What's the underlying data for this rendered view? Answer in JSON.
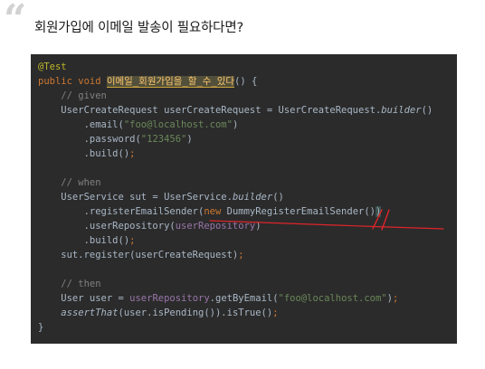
{
  "heading": {
    "quote_glyph": "“",
    "text": "회원가입에 이메일 발송이 필요하다면?"
  },
  "code": {
    "lines": [
      [
        {
          "t": "@Test",
          "c": "ann"
        }
      ],
      [
        {
          "t": "public void ",
          "c": "kw"
        },
        {
          "t": "이메일_회원가입을_할_수_있다",
          "c": "fn-hl"
        },
        {
          "t": "() {",
          "c": ""
        }
      ],
      [
        {
          "t": "    ",
          "c": ""
        },
        {
          "t": "// given",
          "c": "cmt"
        }
      ],
      [
        {
          "t": "    UserCreateRequest userCreateRequest = UserCreateRequest.",
          "c": ""
        },
        {
          "t": "builder",
          "c": "it"
        },
        {
          "t": "()",
          "c": ""
        }
      ],
      [
        {
          "t": "        .email(",
          "c": ""
        },
        {
          "t": "\"foo@localhost.com\"",
          "c": "str"
        },
        {
          "t": ")",
          "c": ""
        }
      ],
      [
        {
          "t": "        .password(",
          "c": ""
        },
        {
          "t": "\"123456\"",
          "c": "str"
        },
        {
          "t": ")",
          "c": ""
        }
      ],
      [
        {
          "t": "        .build()",
          "c": ""
        },
        {
          "t": ";",
          "c": "kw"
        }
      ],
      [
        {
          "t": "",
          "c": ""
        }
      ],
      [
        {
          "t": "    ",
          "c": ""
        },
        {
          "t": "// when",
          "c": "cmt"
        }
      ],
      [
        {
          "t": "    UserService sut = UserService.",
          "c": ""
        },
        {
          "t": "builder",
          "c": "it"
        },
        {
          "t": "()",
          "c": ""
        }
      ],
      [
        {
          "t": "        .registerEmailSender(",
          "c": ""
        },
        {
          "t": "new ",
          "c": "kw"
        },
        {
          "t": "DummyRegisterEmailSender()",
          "c": ""
        },
        {
          "t": ")",
          "c": "sel"
        }
      ],
      [
        {
          "t": "        .userRepository(",
          "c": ""
        },
        {
          "t": "userRepository",
          "c": "fld"
        },
        {
          "t": ")",
          "c": ""
        }
      ],
      [
        {
          "t": "        .build()",
          "c": ""
        },
        {
          "t": ";",
          "c": "kw"
        }
      ],
      [
        {
          "t": "    sut.register(userCreateRequest)",
          "c": ""
        },
        {
          "t": ";",
          "c": "kw"
        }
      ],
      [
        {
          "t": "",
          "c": ""
        }
      ],
      [
        {
          "t": "    ",
          "c": ""
        },
        {
          "t": "// then",
          "c": "cmt"
        }
      ],
      [
        {
          "t": "    User user = ",
          "c": ""
        },
        {
          "t": "userRepository",
          "c": "fld"
        },
        {
          "t": ".getByEmail(",
          "c": ""
        },
        {
          "t": "\"foo@localhost.com\"",
          "c": "str"
        },
        {
          "t": ")",
          "c": ""
        },
        {
          "t": ";",
          "c": "kw"
        }
      ],
      [
        {
          "t": "    ",
          "c": ""
        },
        {
          "t": "assertThat",
          "c": "it"
        },
        {
          "t": "(user.isPending()).isTrue()",
          "c": ""
        },
        {
          "t": ";",
          "c": "kw"
        }
      ],
      [
        {
          "t": "}",
          "c": ""
        }
      ]
    ]
  },
  "colors": {
    "editor_background": "#2b2b2b",
    "annotation_stroke": "#e0242a"
  }
}
